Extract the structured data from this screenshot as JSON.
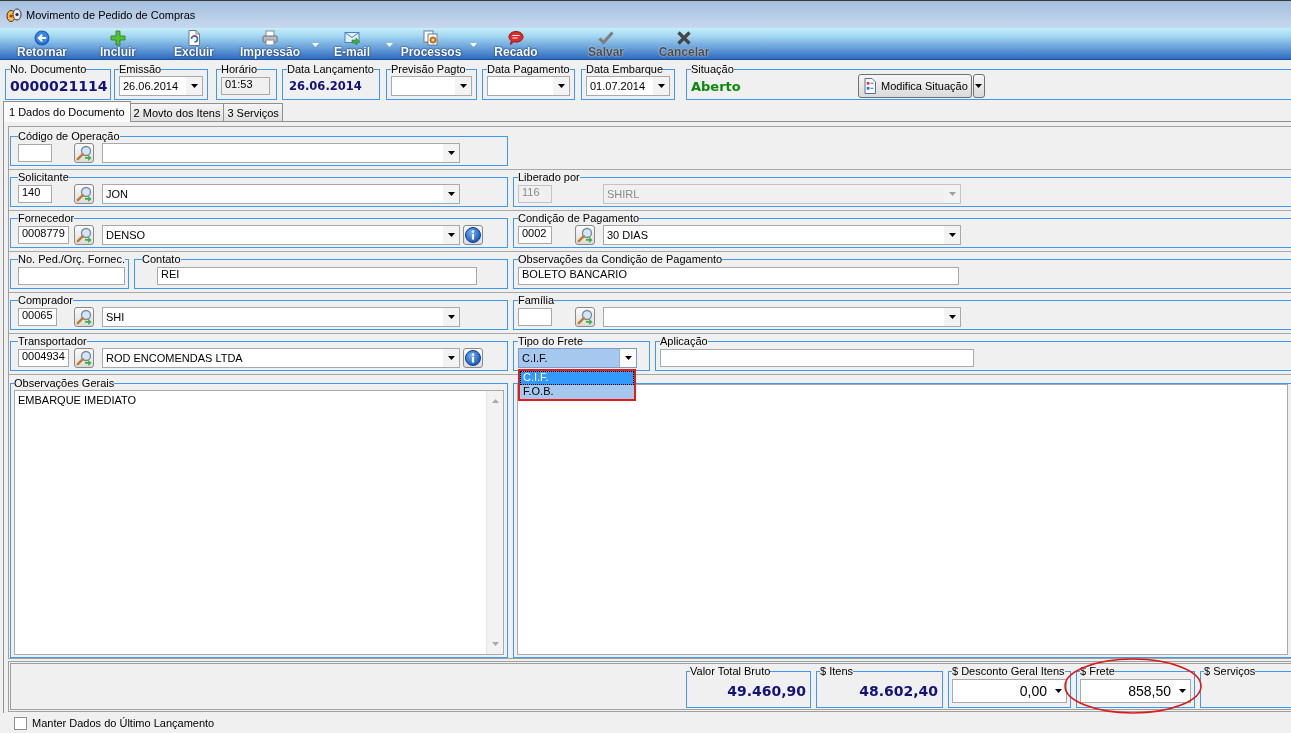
{
  "window": {
    "title": "Movimento de Pedido de Compras"
  },
  "toolbar": [
    {
      "label": "Retornar",
      "dropdown": false,
      "disabled": false
    },
    {
      "label": "Incluir",
      "dropdown": false,
      "disabled": false
    },
    {
      "label": "Excluir",
      "dropdown": false,
      "disabled": false
    },
    {
      "label": "Impressão",
      "dropdown": true,
      "disabled": false
    },
    {
      "label": "E-mail",
      "dropdown": true,
      "disabled": false
    },
    {
      "label": "Processos",
      "dropdown": true,
      "disabled": false
    },
    {
      "label": "Recado",
      "dropdown": false,
      "disabled": false
    },
    {
      "label": "Salvar",
      "dropdown": false,
      "disabled": true
    },
    {
      "label": "Cancelar",
      "dropdown": false,
      "disabled": true
    }
  ],
  "header": [
    {
      "label": "No. Documento",
      "kind": "number",
      "value": "0000021114"
    },
    {
      "label": "Emissão",
      "kind": "combo",
      "value": "26.06.2014"
    },
    {
      "label": "Horário",
      "kind": "readonly",
      "value": "01:53"
    },
    {
      "label": "Data Lançamento",
      "kind": "display",
      "value": "26.06.2014"
    },
    {
      "label": "Previsão Pagto",
      "kind": "combo"
    },
    {
      "label": "Data Pagamento",
      "kind": "combo"
    },
    {
      "label": "Data Embarque",
      "kind": "combo",
      "value": "01.07.2014"
    },
    {
      "label": "Situação",
      "kind": "status",
      "value": "Aberto",
      "button": "Modifica Situação"
    }
  ],
  "tabs": [
    {
      "label": "1 Dados do Documento",
      "selected": true
    },
    {
      "label": "2 Movto dos Itens",
      "selected": false
    },
    {
      "label": "3 Serviços",
      "selected": false
    }
  ],
  "form": {
    "rows": [
      {
        "left": [
          {
            "label": "Código de Operação",
            "kind": "lookup",
            "info_button": false,
            "disabled": false
          }
        ]
      },
      {
        "left": [
          {
            "label": "Solicitante",
            "kind": "lookup",
            "code": "140",
            "value": "JON",
            "info_button": false,
            "disabled": false
          }
        ],
        "right": [
          {
            "label": "Liberado por",
            "kind": "lookup",
            "code": "116",
            "value": "SHIRL",
            "info_button": false,
            "disabled": true
          }
        ]
      },
      {
        "left": [
          {
            "label": "Fornecedor",
            "kind": "lookup",
            "code": "0008779",
            "value": "DENSO",
            "info_button": true,
            "disabled": false
          }
        ],
        "right": [
          {
            "label": "Condição de Pagamento",
            "kind": "lookup",
            "code": "0002",
            "value": "30 DIAS",
            "info_button": false,
            "disabled": false
          }
        ]
      },
      {
        "left": [
          {
            "label": "No. Ped./Orç. Fornec.",
            "kind": "text",
            "disabled": false
          },
          {
            "label": "Contato",
            "kind": "text",
            "value": "REI",
            "disabled": false
          }
        ],
        "right": [
          {
            "label": "Observações da Condição de Pagamento",
            "kind": "text",
            "value": "BOLETO BANCARIO",
            "disabled": false
          }
        ]
      },
      {
        "left": [
          {
            "label": "Comprador",
            "kind": "lookup",
            "code": "00065",
            "value": "SHI",
            "info_button": false,
            "disabled": false
          }
        ],
        "right": [
          {
            "label": "Família",
            "kind": "lookup",
            "info_button": false,
            "disabled": false
          }
        ]
      },
      {
        "left": [
          {
            "label": "Transportador",
            "kind": "lookup",
            "code": "0004934",
            "value": "ROD ENCOMENDAS LTDA",
            "info_button": true,
            "disabled": false
          }
        ],
        "right": [
          {
            "label": "Tipo do Frete",
            "kind": "select",
            "value": "C.I.F.",
            "expanded": true,
            "highlighted": true,
            "disabled": false,
            "options": [
              {
                "label": "C.I.F.",
                "selected": true
              },
              {
                "label": "F.O.B.",
                "selected": false
              }
            ]
          },
          {
            "label": "Aplicação",
            "kind": "text",
            "disabled": false
          }
        ]
      },
      {
        "left": [
          {
            "label": "Observações Gerais",
            "kind": "memo",
            "value": "EMBARQUE IMEDIATO",
            "disabled": false
          }
        ],
        "right": [
          {
            "kind": "memo",
            "disabled": false
          }
        ]
      }
    ]
  },
  "totals": [
    {
      "label": "Valor Total Bruto",
      "kind": "display",
      "value": "49.460,90",
      "highlighted": false
    },
    {
      "label": "$ Itens",
      "kind": "display",
      "value": "48.602,40",
      "highlighted": false
    },
    {
      "label": "$ Desconto Geral Itens",
      "kind": "combo",
      "value": "0,00",
      "highlighted": false
    },
    {
      "label": "$ Frete",
      "kind": "combo",
      "value": "858,50",
      "highlighted": true
    },
    {
      "label": "$ Serviços",
      "kind": "display",
      "highlighted": false
    }
  ],
  "footer": {
    "label": "Manter Dados do Último Lançamento",
    "checked": false
  }
}
